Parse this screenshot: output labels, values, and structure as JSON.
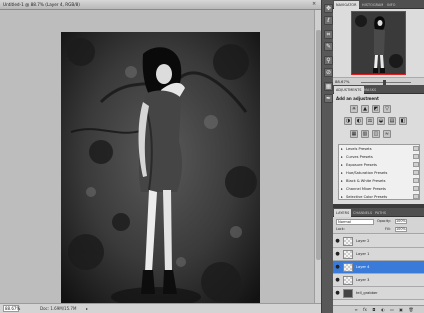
{
  "document": {
    "tab_title": "Untitled-1 @ 88.7% (Layer 4, RGB/8)",
    "close_glyph": "×",
    "status_zoom": "88.67%",
    "status_doc": "Doc: 1.69M/15.7M",
    "status_arrow": "▸"
  },
  "tools": {
    "icons": [
      "move-icon",
      "lasso-icon",
      "crop-icon",
      "brush-icon",
      "clone-stamp-icon",
      "eraser-icon",
      "gradient-icon",
      "pen-icon"
    ],
    "glyphs": [
      "✥",
      "ℓ",
      "⌗",
      "✎",
      "⚲",
      "⊘",
      "▦",
      "✒"
    ]
  },
  "navigator": {
    "tabs": [
      "NAVIGATOR",
      "HISTOGRAM",
      "INFO"
    ],
    "zoom": "88.67%",
    "frame_color": "#e02020"
  },
  "adjustments": {
    "tabs": [
      "ADJUSTMENTS",
      "MASKS"
    ],
    "title": "Add an adjustment",
    "icon_glyphs": [
      "☀",
      "▲",
      "◩",
      "▽",
      "◑",
      "◐",
      "⚖",
      "◒",
      "▤",
      "◧",
      "▦",
      "▥",
      "◫",
      "≈"
    ],
    "presets": [
      "Levels Presets",
      "Curves Presets",
      "Exposure Presets",
      "Hue/Saturation Presets",
      "Black & White Presets",
      "Channel Mixer Presets",
      "Selective Color Presets"
    ]
  },
  "layers": {
    "tabs": [
      "LAYERS",
      "CHANNELS",
      "PATHS"
    ],
    "blend_mode": "Normal",
    "opacity_label": "Opacity:",
    "opacity_value": "100%",
    "lock_label": "Lock:",
    "fill_label": "Fill:",
    "fill_value": "100%",
    "eye_glyph": "●",
    "items": [
      "Layer 2",
      "Layer 1",
      "Layer 4",
      "Layer 3",
      "tell_grabber"
    ],
    "selected_index": 2,
    "selected_color": "#3a7ad8",
    "footer_icons": [
      "link-icon",
      "fx-icon",
      "mask-icon",
      "adjustment-icon",
      "group-icon",
      "new-layer-icon",
      "trash-icon"
    ],
    "footer_glyphs": [
      "∞",
      "fx",
      "◘",
      "◐",
      "▭",
      "▣",
      "🗑"
    ]
  }
}
